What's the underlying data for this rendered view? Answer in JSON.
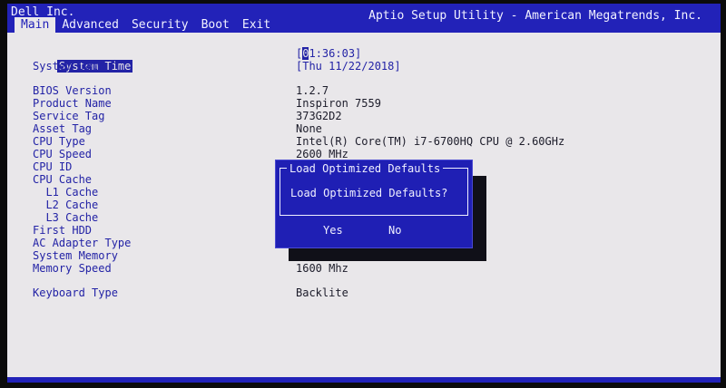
{
  "header": {
    "brand": "Dell Inc.",
    "app_title": "Aptio Setup Utility - American Megatrends, Inc."
  },
  "menu": {
    "tabs": [
      {
        "label": "Main"
      },
      {
        "label": "Advanced"
      },
      {
        "label": "Security"
      },
      {
        "label": "Boot"
      },
      {
        "label": "Exit"
      }
    ]
  },
  "main": {
    "system_time": {
      "label": "System Time",
      "value_prefix": "[",
      "cursor": "0",
      "value_rest": "1:36:03]"
    },
    "system_date": {
      "label": "System Date",
      "value": "[Thu 11/22/2018]"
    },
    "info": [
      {
        "label": "BIOS Version",
        "value": "1.2.7"
      },
      {
        "label": "Product Name",
        "value": "Inspiron 7559"
      },
      {
        "label": "Service Tag",
        "value": "373G2D2"
      },
      {
        "label": "Asset Tag",
        "value": "None"
      },
      {
        "label": "CPU Type",
        "value": "Intel(R) Core(TM) i7-6700HQ CPU @ 2.60GHz"
      },
      {
        "label": "CPU Speed",
        "value": "2600 MHz"
      },
      {
        "label": "CPU ID",
        "value": ""
      },
      {
        "label": "CPU Cache",
        "value": ""
      },
      {
        "label": "  L1 Cache",
        "value": ""
      },
      {
        "label": "  L2 Cache",
        "value": ""
      },
      {
        "label": "  L3 Cache",
        "value": ""
      },
      {
        "label": "First HDD",
        "value": ""
      },
      {
        "label": "AC Adapter Type",
        "value": ""
      },
      {
        "label": "System Memory",
        "value": ""
      },
      {
        "label": "Memory Speed",
        "value": "1600 Mhz"
      }
    ],
    "keyboard_type": {
      "label": "Keyboard Type",
      "value": "Backlite"
    }
  },
  "dialog": {
    "title": "Load Optimized Defaults",
    "message": "Load Optimized Defaults?",
    "yes_label": "Yes",
    "no_label": "No"
  },
  "colors": {
    "bar_blue": "#2222b8",
    "screen_bg": "#e9e7ea",
    "label_blue": "#2323a6"
  }
}
